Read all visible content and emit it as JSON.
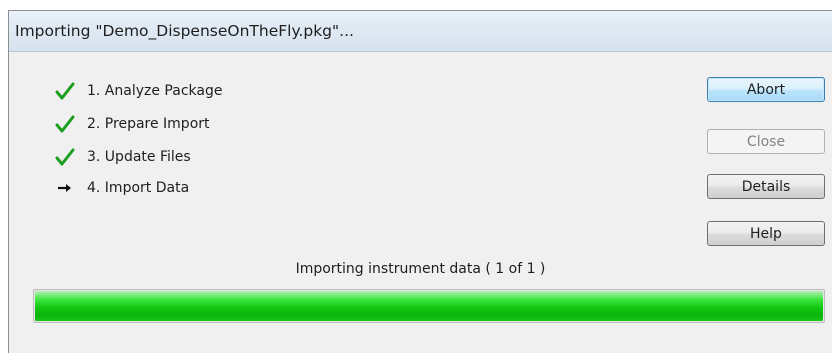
{
  "window": {
    "title": "Importing \"Demo_DispenseOnTheFly.pkg\"..."
  },
  "steps": [
    {
      "label": "1. Analyze Package",
      "state": "done",
      "icon": "check-icon"
    },
    {
      "label": "2. Prepare Import",
      "state": "done",
      "icon": "check-icon"
    },
    {
      "label": "3. Update Files",
      "state": "done",
      "icon": "check-icon"
    },
    {
      "label": "4. Import Data",
      "state": "current",
      "icon": "arrow-right-icon"
    }
  ],
  "buttons": {
    "abort": "Abort",
    "close": "Close",
    "details": "Details",
    "help": "Help"
  },
  "status": {
    "text": "Importing instrument data ( 1 of 1 )"
  },
  "progress": {
    "fraction": 1.0
  },
  "colors": {
    "check": "#1e9e1e",
    "progress_fill": "#14c814",
    "default_button_border": "#3c7fb1"
  }
}
